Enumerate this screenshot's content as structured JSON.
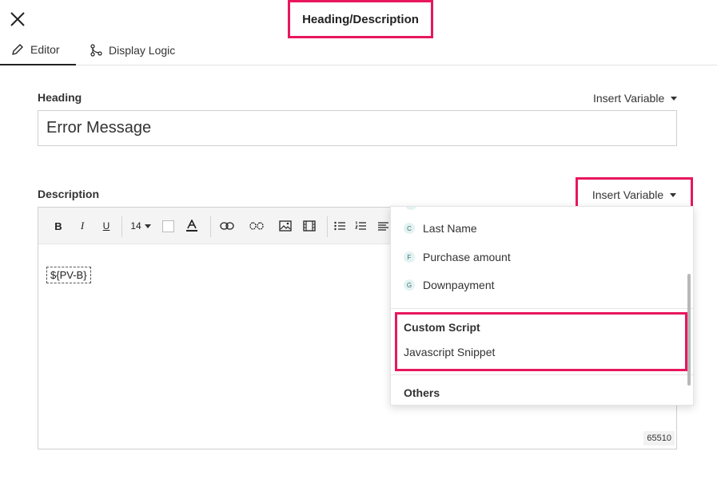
{
  "header": {
    "title": "Heading/Description"
  },
  "tabs": [
    {
      "label": "Editor",
      "active": true
    },
    {
      "label": "Display Logic",
      "active": false
    }
  ],
  "heading": {
    "label": "Heading",
    "insert_variable": "Insert Variable",
    "value": "Error Message"
  },
  "description": {
    "label": "Description",
    "insert_variable": "Insert Variable",
    "font_size": "14",
    "content": "${PV-B}",
    "char_count": "65510"
  },
  "toolbar": {
    "icons": [
      "bold-icon",
      "italic-icon",
      "underline-icon",
      "font-size-select",
      "text-color-swatch",
      "font-color-icon",
      "link-icon",
      "unlink-icon",
      "image-icon",
      "video-icon",
      "bullet-list-icon",
      "numbered-list-icon",
      "align-icon"
    ]
  },
  "variable_dropdown": {
    "items": [
      {
        "badge": "C",
        "label": "Last Name"
      },
      {
        "badge": "F",
        "label": "Purchase amount"
      },
      {
        "badge": "G",
        "label": "Downpayment"
      }
    ],
    "custom_script": {
      "title": "Custom Script",
      "item": "Javascript Snippet"
    },
    "others": {
      "title": "Others"
    }
  },
  "colors": {
    "highlight": "#e8175d",
    "badge_bg": "#e3f2f2",
    "toolbar_bg": "#f4f4f4"
  }
}
